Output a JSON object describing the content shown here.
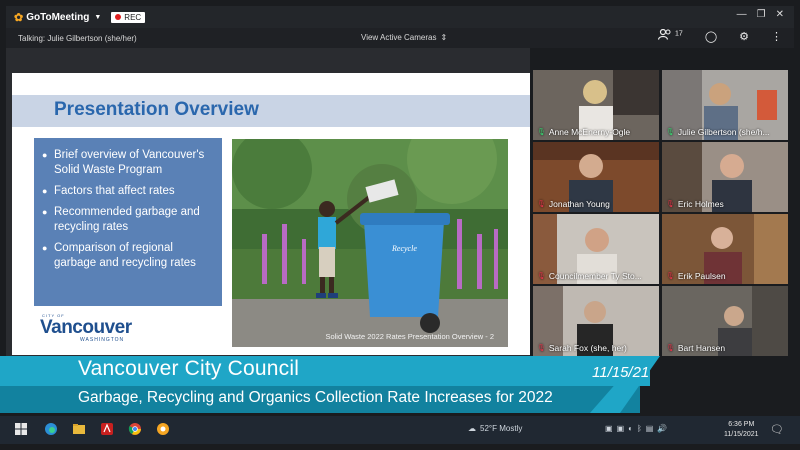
{
  "window": {
    "app_name": "GoToMeeting",
    "rec_label": "REC"
  },
  "subbar": {
    "talking": "Talking: Julie Gilbertson (she/her)",
    "view_cameras": "View Active Cameras",
    "attendee_count": "17"
  },
  "slide": {
    "title": "Presentation Overview",
    "bullets": [
      "Brief overview of Vancouver's Solid Waste Program",
      "Factors that affect rates",
      "Recommended garbage and recycling rates",
      "Comparison of regional garbage and recycling rates"
    ],
    "logo_top": "CITY OF",
    "logo_name": "Vancouver",
    "logo_sub": "WASHINGTON",
    "caption": "Solid Waste 2022 Rates Presentation Overview - 2",
    "bin_text": "Recycle"
  },
  "participants": [
    {
      "name": "Anne McEnerny-Ogle",
      "mic": "on"
    },
    {
      "name": "Julie Gilbertson (she/h...",
      "mic": "on"
    },
    {
      "name": "Jonathan Young",
      "mic": "off"
    },
    {
      "name": "Eric Holmes",
      "mic": "off"
    },
    {
      "name": "Councilmember Ty Sto...",
      "mic": "off"
    },
    {
      "name": "Erik Paulsen",
      "mic": "off"
    },
    {
      "name": "Sarah Fox (she, her)",
      "mic": "off"
    },
    {
      "name": "Bart Hansen",
      "mic": "off"
    }
  ],
  "lower_third": {
    "title": "Vancouver City Council",
    "date": "11/15/21",
    "subtitle": "Garbage, Recycling and Organics Collection Rate Increases for 2022"
  },
  "taskbar": {
    "weather": "52°F  Mostly",
    "time": "6:36 PM",
    "date": "11/15/2021"
  },
  "colors": {
    "lower_third_light": "#1fa6c7",
    "lower_third_dark": "#12829f",
    "slide_title": "#2a67ad",
    "bullet_box": "#5a81b6",
    "mic_on": "#3cd070",
    "mic_off": "#e0354a"
  }
}
